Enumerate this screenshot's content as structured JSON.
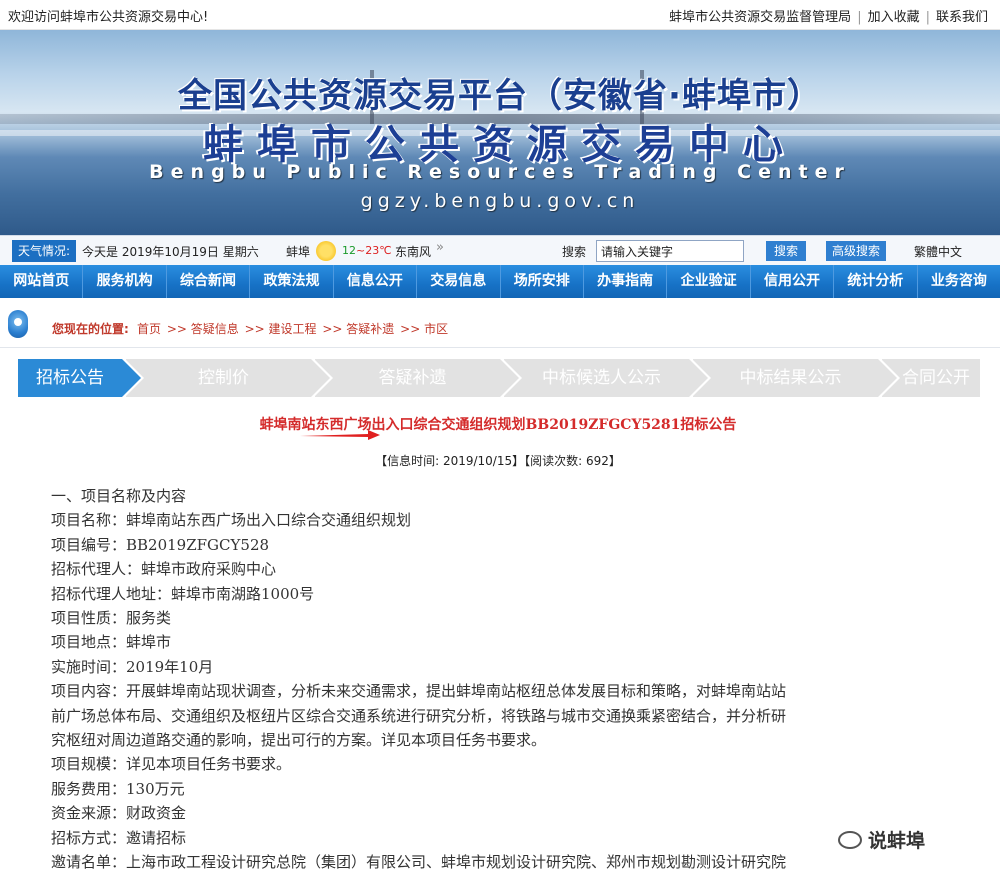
{
  "topbar": {
    "welcome": "欢迎访问蚌埠市公共资源交易中心!",
    "links": [
      "蚌埠市公共资源交易监督管理局",
      "加入收藏",
      "联系我们"
    ]
  },
  "banner": {
    "title_cn1": "全国公共资源交易平台（安徽省·蚌埠市）",
    "title_cn2": "蚌埠市公共资源交易中心",
    "title_en": "Bengbu Public Resources Trading Center",
    "domain": "ggzy.bengbu.gov.cn"
  },
  "infobar": {
    "weather_label": "天气情况:",
    "date": "今天是 2019年10月19日 星期六",
    "city": "蚌埠",
    "temp_low": "12",
    "temp_sep": "~",
    "temp_high": "23℃",
    "wind": "东南风",
    "more": "»",
    "search_label": "搜索",
    "search_value": "请输入关键字",
    "search_button": "搜索",
    "advanced_button": "高级搜索",
    "traditional": "繁體中文"
  },
  "nav": {
    "items": [
      "网站首页",
      "服务机构",
      "综合新闻",
      "政策法规",
      "信息公开",
      "交易信息",
      "场所安排",
      "办事指南",
      "企业验证",
      "信用公开",
      "统计分析",
      "业务咨询"
    ]
  },
  "breadcrumb": {
    "label": "您现在的位置:",
    "trail": [
      "首页",
      ">> 答疑信息",
      ">> 建设工程",
      ">> 答疑补遗",
      ">> 市区"
    ]
  },
  "steps": [
    "招标公告",
    "控制价",
    "答疑补遗",
    "中标候选人公示",
    "中标结果公示",
    "合同公开"
  ],
  "article": {
    "title": "蚌埠南站东西广场出入口综合交通组织规划BB2019ZFGCY5281招标公告",
    "meta": "【信息时间: 2019/10/15】【阅读次数: 692】",
    "lines": [
      "一、项目名称及内容",
      "项目名称：蚌埠南站东西广场出入口综合交通组织规划",
      "项目编号：BB2019ZFGCY528",
      "招标代理人：蚌埠市政府采购中心",
      "招标代理人地址：蚌埠市南湖路1000号",
      "项目性质：服务类",
      "项目地点：蚌埠市",
      "实施时间：2019年10月",
      "项目内容：开展蚌埠南站现状调查，分析未来交通需求，提出蚌埠南站枢纽总体发展目标和策略，对蚌埠南站站",
      "前广场总体布局、交通组织及枢纽片区综合交通系统进行研究分析，将铁路与城市交通换乘紧密结合，并分析研",
      "究枢纽对周边道路交通的影响，提出可行的方案。详见本项目任务书要求。",
      "项目规模：详见本项目任务书要求。",
      "服务费用：130万元",
      "资金来源：财政资金",
      "招标方式：邀请招标",
      "邀请名单：上海市政工程设计研究总院（集团）有限公司、蚌埠市规划设计研究院、郑州市规划勘测设计研究院"
    ]
  },
  "watermark": "说蚌埠"
}
